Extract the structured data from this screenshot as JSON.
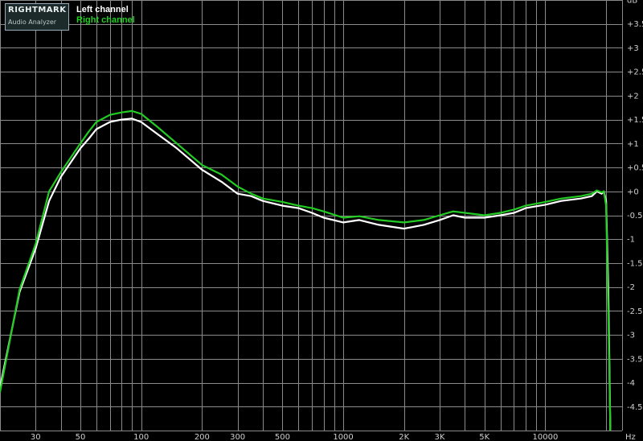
{
  "logo": {
    "brand": "RIGHTMARK",
    "product": "Audio Analyzer"
  },
  "chart_data": {
    "type": "line",
    "title": "",
    "xlabel": "Hz",
    "ylabel": "dB",
    "x_scale": "log",
    "xlim": [
      20,
      24000
    ],
    "ylim": [
      -5,
      4
    ],
    "x_tick_labels": [
      {
        "x": 30,
        "label": "30"
      },
      {
        "x": 50,
        "label": "50"
      },
      {
        "x": 100,
        "label": "100"
      },
      {
        "x": 200,
        "label": "200"
      },
      {
        "x": 300,
        "label": "300"
      },
      {
        "x": 500,
        "label": "500"
      },
      {
        "x": 1000,
        "label": "1000"
      },
      {
        "x": 2000,
        "label": "2K"
      },
      {
        "x": 3000,
        "label": "3K"
      },
      {
        "x": 5000,
        "label": "5K"
      },
      {
        "x": 10000,
        "label": "10000"
      }
    ],
    "y_tick_labels": [
      {
        "y": 4,
        "label": "dB"
      },
      {
        "y": 3.5,
        "label": "+3.5"
      },
      {
        "y": 3,
        "label": "+3"
      },
      {
        "y": 2.5,
        "label": "+2.5"
      },
      {
        "y": 2,
        "label": "+2"
      },
      {
        "y": 1.5,
        "label": "+1.5"
      },
      {
        "y": 1,
        "label": "+1"
      },
      {
        "y": 0.5,
        "label": "+0.5"
      },
      {
        "y": 0,
        "label": "+0"
      },
      {
        "y": -0.5,
        "label": "-0.5"
      },
      {
        "y": -1,
        "label": "-1"
      },
      {
        "y": -1.5,
        "label": "-1.5"
      },
      {
        "y": -2,
        "label": "-2"
      },
      {
        "y": -2.5,
        "label": "-2.5"
      },
      {
        "y": -3,
        "label": "-3"
      },
      {
        "y": -3.5,
        "label": "-3.5"
      },
      {
        "y": -4,
        "label": "-4"
      },
      {
        "y": -4.5,
        "label": "-4.5"
      }
    ],
    "x_unit_label": "Hz",
    "grid": true,
    "legend_position": "top-left",
    "series": [
      {
        "name": "Left channel",
        "color": "#ffffff",
        "points": [
          [
            20,
            -4.1
          ],
          [
            25,
            -2.1
          ],
          [
            30,
            -1.2
          ],
          [
            35,
            -0.2
          ],
          [
            40,
            0.3
          ],
          [
            50,
            0.9
          ],
          [
            55,
            1.1
          ],
          [
            60,
            1.3
          ],
          [
            70,
            1.45
          ],
          [
            80,
            1.5
          ],
          [
            90,
            1.52
          ],
          [
            100,
            1.45
          ],
          [
            120,
            1.2
          ],
          [
            150,
            0.9
          ],
          [
            200,
            0.45
          ],
          [
            250,
            0.2
          ],
          [
            300,
            -0.05
          ],
          [
            350,
            -0.1
          ],
          [
            400,
            -0.2
          ],
          [
            500,
            -0.3
          ],
          [
            600,
            -0.35
          ],
          [
            700,
            -0.45
          ],
          [
            800,
            -0.55
          ],
          [
            1000,
            -0.65
          ],
          [
            1200,
            -0.6
          ],
          [
            1500,
            -0.7
          ],
          [
            2000,
            -0.78
          ],
          [
            2500,
            -0.7
          ],
          [
            3000,
            -0.6
          ],
          [
            3500,
            -0.5
          ],
          [
            4000,
            -0.55
          ],
          [
            5000,
            -0.55
          ],
          [
            6000,
            -0.5
          ],
          [
            7000,
            -0.45
          ],
          [
            8000,
            -0.35
          ],
          [
            10000,
            -0.28
          ],
          [
            12000,
            -0.2
          ],
          [
            15000,
            -0.15
          ],
          [
            17000,
            -0.1
          ],
          [
            18000,
            0.0
          ],
          [
            19000,
            -0.05
          ],
          [
            19500,
            0.0
          ],
          [
            20000,
            -0.2
          ],
          [
            20500,
            -2.0
          ],
          [
            21000,
            -5.0
          ]
        ]
      },
      {
        "name": "Right channel",
        "color": "#22cc22",
        "points": [
          [
            20,
            -4.2
          ],
          [
            25,
            -2.05
          ],
          [
            30,
            -1.1
          ],
          [
            35,
            0.0
          ],
          [
            40,
            0.4
          ],
          [
            50,
            1.0
          ],
          [
            55,
            1.25
          ],
          [
            60,
            1.45
          ],
          [
            70,
            1.6
          ],
          [
            80,
            1.65
          ],
          [
            90,
            1.68
          ],
          [
            100,
            1.62
          ],
          [
            120,
            1.35
          ],
          [
            150,
            1.0
          ],
          [
            200,
            0.55
          ],
          [
            250,
            0.35
          ],
          [
            300,
            0.1
          ],
          [
            350,
            -0.05
          ],
          [
            400,
            -0.15
          ],
          [
            500,
            -0.22
          ],
          [
            600,
            -0.3
          ],
          [
            700,
            -0.35
          ],
          [
            800,
            -0.42
          ],
          [
            1000,
            -0.55
          ],
          [
            1200,
            -0.52
          ],
          [
            1500,
            -0.6
          ],
          [
            2000,
            -0.65
          ],
          [
            2500,
            -0.6
          ],
          [
            3000,
            -0.5
          ],
          [
            3500,
            -0.42
          ],
          [
            4000,
            -0.45
          ],
          [
            5000,
            -0.5
          ],
          [
            6000,
            -0.45
          ],
          [
            7000,
            -0.38
          ],
          [
            8000,
            -0.3
          ],
          [
            10000,
            -0.22
          ],
          [
            12000,
            -0.15
          ],
          [
            15000,
            -0.1
          ],
          [
            17000,
            -0.05
          ],
          [
            18000,
            0.02
          ],
          [
            19000,
            -0.02
          ],
          [
            19500,
            0.0
          ],
          [
            20000,
            -0.3
          ],
          [
            20500,
            -2.5
          ],
          [
            21000,
            -5.0
          ]
        ]
      }
    ]
  }
}
